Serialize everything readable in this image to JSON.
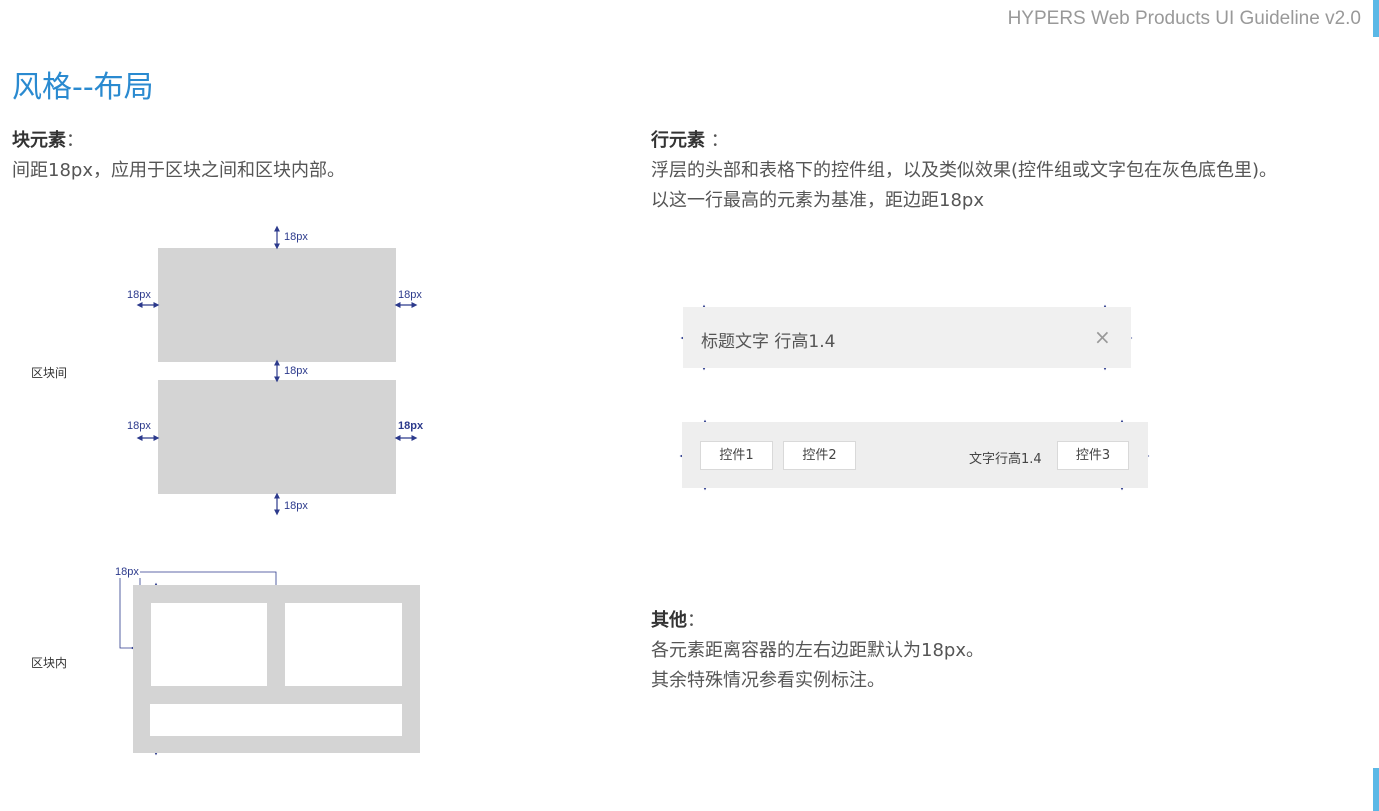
{
  "header": {
    "title": "HYPERS Web Products UI Guideline v2.0"
  },
  "page": {
    "title": "风格--布局"
  },
  "block_section": {
    "heading": "块元素",
    "colon": "：",
    "desc": "间距18px，应用于区块之间和区块内部。",
    "between_label": "区块间",
    "inside_label": "区块内",
    "spacing": "18px",
    "spacing_bold": "18px"
  },
  "row_section": {
    "heading": "行元素",
    "colon": " ：",
    "line1": "浮层的头部和表格下的控件组，以及类似效果(控件组或文字包在灰色底色里)。",
    "line2": "以这一行最高的元素为基准，距边距18px",
    "title_text": "标题文字 行高1.4",
    "close_icon": "×",
    "control1": "控件1",
    "control2": "控件2",
    "text_lh": "文字行高1.4",
    "control3": "控件3"
  },
  "other_section": {
    "heading": "其他",
    "colon": "：",
    "line1": "各元素距离容器的左右边距默认为18px。",
    "line2": "其余特殊情况参看实例标注。"
  },
  "colors": {
    "accent": "#5bb8e6",
    "title": "#2a8ad0",
    "annotation": "#2c3a8c",
    "block": "#d4d4d4"
  }
}
